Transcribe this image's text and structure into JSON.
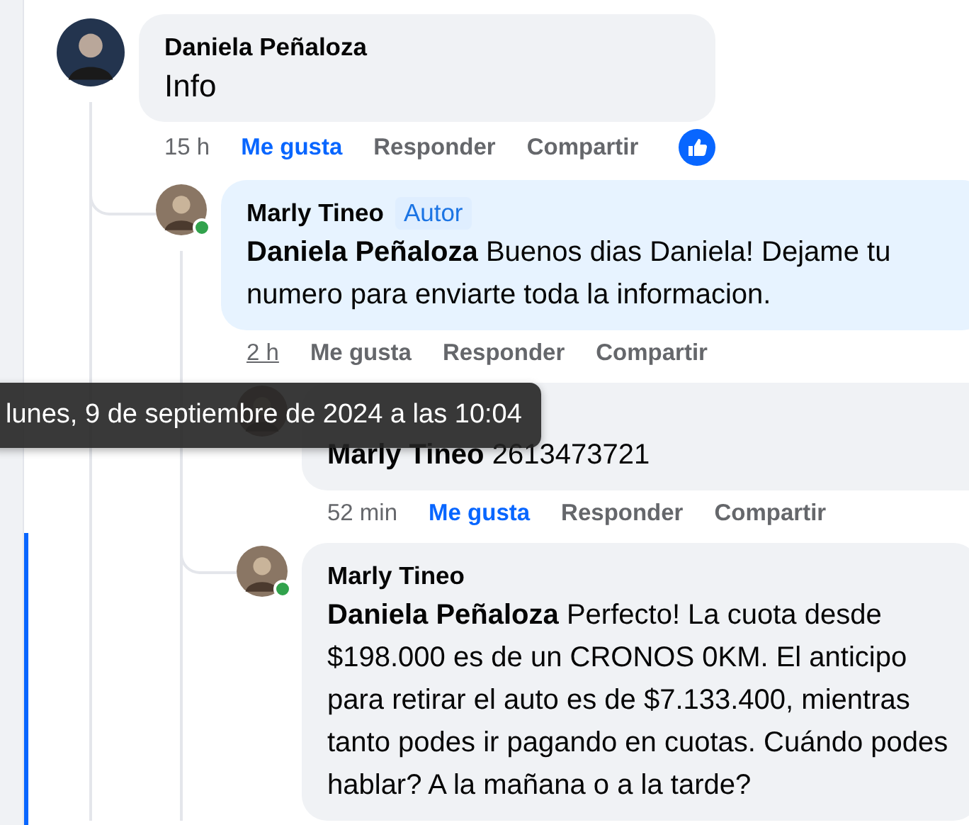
{
  "comments": [
    {
      "author": "Daniela Peñaloza",
      "text": "Info",
      "large_text": true,
      "time": "15 h",
      "liked": true,
      "actions": [
        "Me gusta",
        "Responder",
        "Compartir"
      ],
      "reacted": true,
      "children": [
        {
          "author": "Marly Tineo",
          "badge": "Autor",
          "mention": "Daniela Peñaloza",
          "text": "Buenos dias Daniela! Dejame tu numero para enviarte toda la informacion.",
          "online": true,
          "time": "2 h",
          "time_hovered": true,
          "liked": false,
          "actions": [
            "Me gusta",
            "Responder",
            "Compartir"
          ],
          "children": [
            {
              "mention": "Marly Tineo",
              "text": "2613473721",
              "time": "52 min",
              "liked": true,
              "actions": [
                "Me gusta",
                "Responder",
                "Compartir"
              ]
            },
            {
              "author": "Marly Tineo",
              "mention": "Daniela Peñaloza",
              "text": "Perfecto! La cuota desde $198.000 es de un CRONOS 0KM. El anticipo para retirar el auto es de $7.133.400, mientras tanto podes ir pagando en cuotas. Cuándo podes hablar? A la mañana o a la tarde?",
              "online": true,
              "focused": true
            }
          ]
        }
      ]
    }
  ],
  "tooltip": "lunes, 9 de septiembre de 2024 a las 10:04"
}
